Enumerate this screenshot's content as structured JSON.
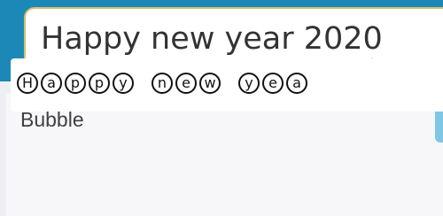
{
  "input": {
    "value": "Happy new year 2020"
  },
  "style_card": {
    "title": "Bubble",
    "preview_words": [
      [
        "H",
        "a",
        "p",
        "p",
        "y"
      ],
      [
        "n",
        "e",
        "w"
      ],
      [
        "y",
        "e",
        "a"
      ]
    ]
  },
  "colors": {
    "header_bg": "#1b88b8",
    "input_border": "#d6c06a",
    "cursor_handle": "#e8457c",
    "card_action": "#7fc6e6"
  }
}
